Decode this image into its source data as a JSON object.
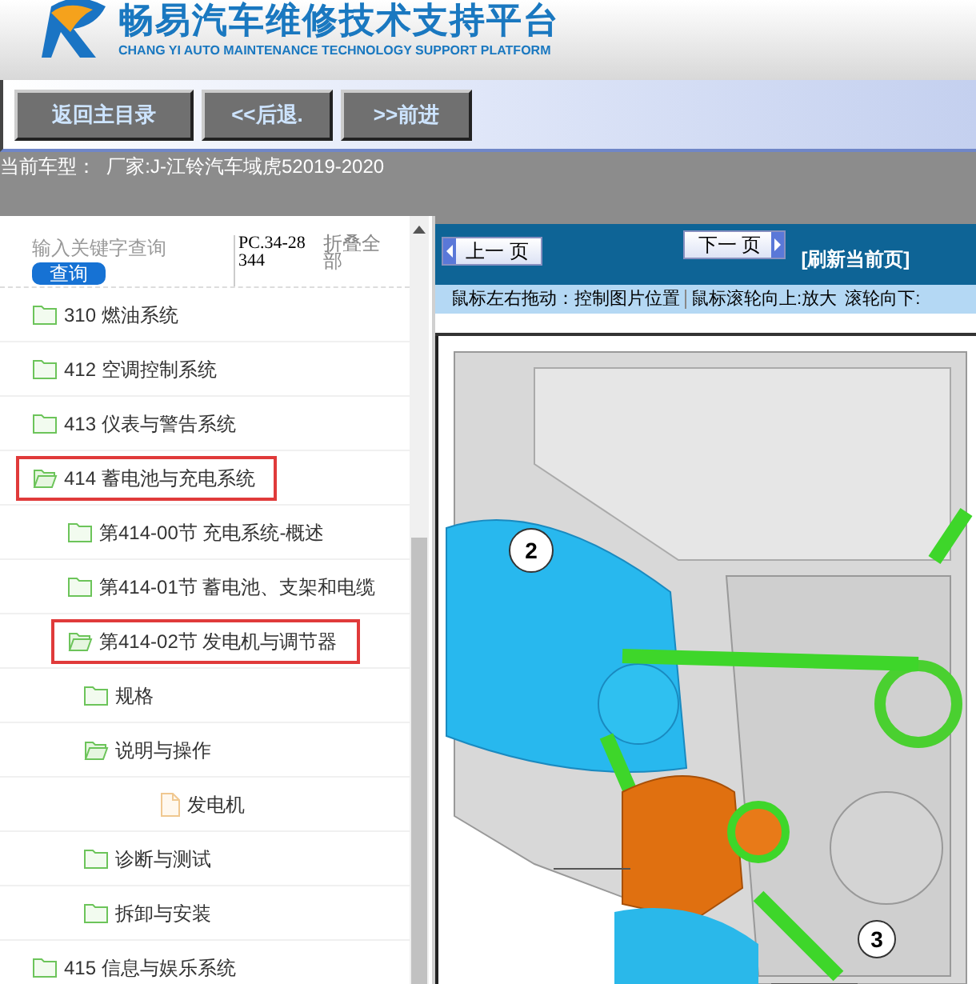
{
  "header": {
    "title": "畅易汽车维修技术支持平台",
    "subtitle": "CHANG YI AUTO MAINTENANCE TECHNOLOGY SUPPORT PLATFORM"
  },
  "nav_buttons": [
    "返回主目录",
    "<<后退.",
    ">>前进"
  ],
  "current_model": "当前车型：  厂家:J-江铃汽车域虎52019-2020",
  "sidebar": {
    "search": {
      "placeholder": "输入关键字查询",
      "button": "查询"
    },
    "code": "PC.34-28344",
    "collapse_all": "折叠全部",
    "tree": [
      {
        "label": "310 燃油系统",
        "kind": "folder",
        "expanded": false,
        "highlighted": false
      },
      {
        "label": "412 空调控制系统",
        "kind": "folder",
        "expanded": false,
        "highlighted": false
      },
      {
        "label": "413 仪表与警告系统",
        "kind": "folder",
        "expanded": false,
        "highlighted": false
      },
      {
        "label": "414 蓄电池与充电系统",
        "kind": "folder",
        "expanded": true,
        "highlighted": true,
        "children": [
          {
            "label": "第414-00节 充电系统-概述",
            "kind": "folder",
            "expanded": false,
            "highlighted": false
          },
          {
            "label": "第414-01节 蓄电池、支架和电缆",
            "kind": "folder",
            "expanded": false,
            "highlighted": false
          },
          {
            "label": "第414-02节 发电机与调节器",
            "kind": "folder",
            "expanded": true,
            "highlighted": true,
            "children": [
              {
                "label": "规格",
                "kind": "folder",
                "expanded": false,
                "highlighted": false
              },
              {
                "label": "说明与操作",
                "kind": "folder",
                "expanded": true,
                "highlighted": false,
                "children": [
                  {
                    "label": "发电机",
                    "kind": "file",
                    "expanded": false,
                    "highlighted": false
                  }
                ]
              },
              {
                "label": "诊断与测试",
                "kind": "folder",
                "expanded": false,
                "highlighted": false
              },
              {
                "label": "拆卸与安装",
                "kind": "folder",
                "expanded": false,
                "highlighted": false
              }
            ]
          }
        ]
      },
      {
        "label": "415 信息与娱乐系统",
        "kind": "folder",
        "expanded": false,
        "highlighted": false
      }
    ]
  },
  "viewer": {
    "prev_button": "上一 页",
    "next_button": "下一 页",
    "refresh_link": "[刷新当前页]",
    "hints": [
      "鼠标左右拖动：控制图片位置",
      "鼠标滚轮向上:放大",
      "滚轮向下:"
    ],
    "callouts": [
      "2",
      "3"
    ]
  }
}
